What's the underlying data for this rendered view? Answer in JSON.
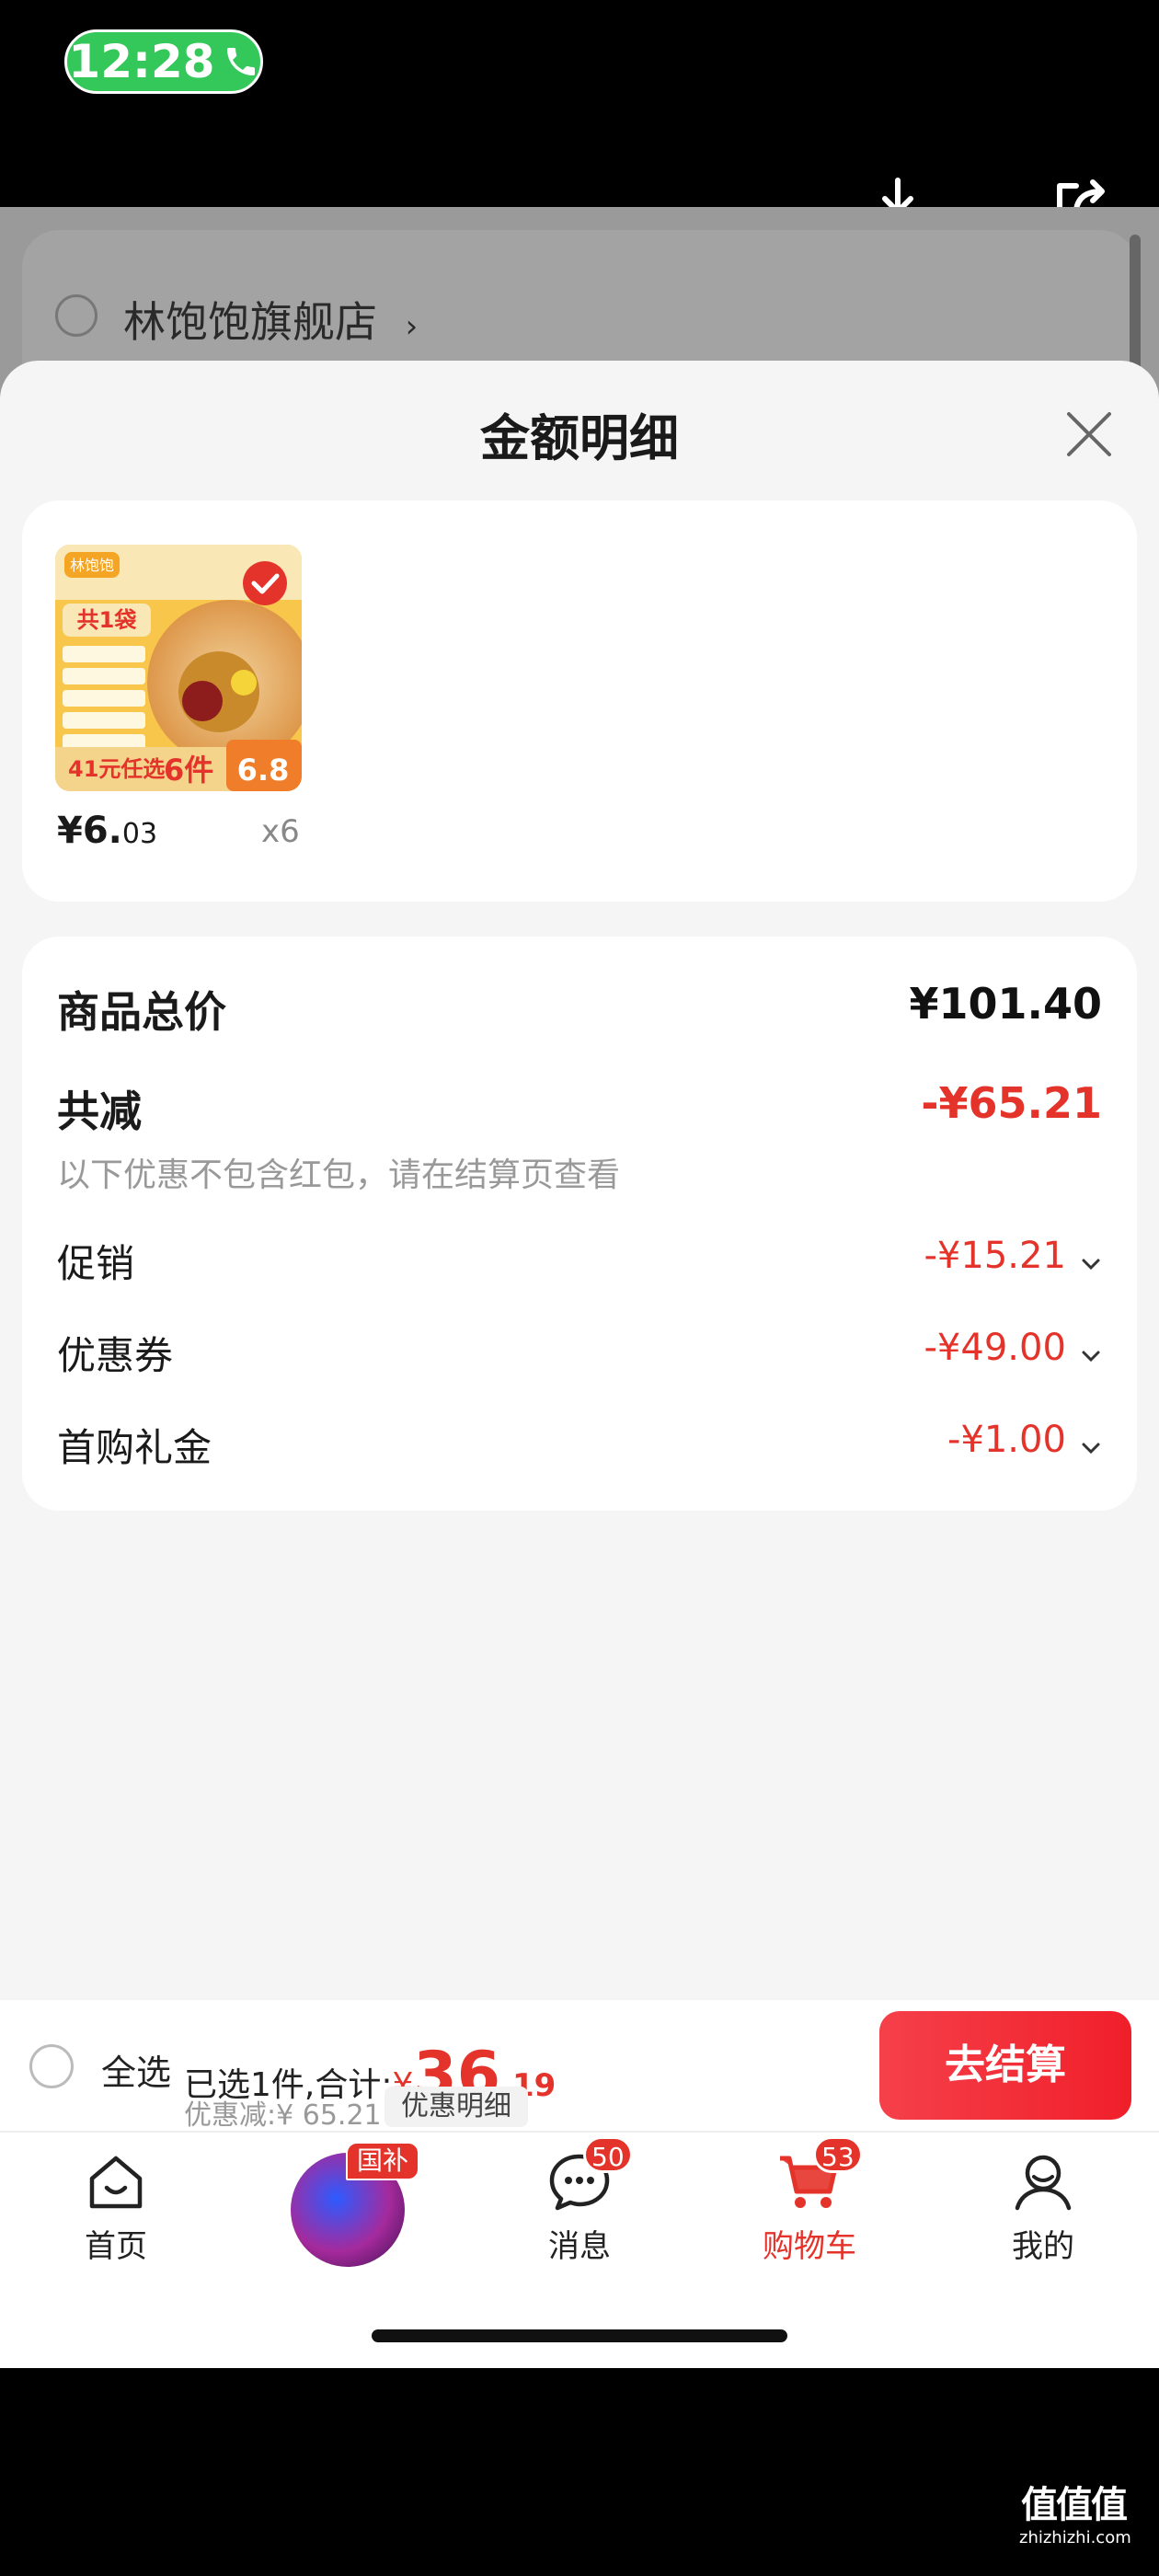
{
  "status": {
    "time": "12:28"
  },
  "store": {
    "name": "林饱饱旗舰店",
    "chevron": "›"
  },
  "sheet": {
    "title": "金额明细"
  },
  "product": {
    "price_main": "¥6.",
    "price_cents": "03",
    "qty": "x6",
    "image_texts": [
      "林饱饱",
      "共1袋",
      "41元任选",
      "6件",
      "6.8"
    ]
  },
  "summary": {
    "total_label": "商品总价",
    "total_value": "¥101.40",
    "reduce_label": "共减",
    "reduce_value": "-¥65.21",
    "note": "以下优惠不包含红包，请在结算页查看",
    "items": [
      {
        "label": "促销",
        "value": "-¥15.21"
      },
      {
        "label": "优惠券",
        "value": "-¥49.00"
      },
      {
        "label": "首购礼金",
        "value": "-¥1.00"
      }
    ]
  },
  "checkout": {
    "select_all": "全选",
    "selected_prefix": "已选1件,合计:",
    "yen": "¥",
    "amount_int": "36",
    "amount_dec": ".19",
    "discount": "优惠减:¥ 65.21",
    "detail_tag": "优惠明细",
    "pay": "去结算"
  },
  "tabs": [
    {
      "label": "首页",
      "icon": "home-icon"
    },
    {
      "label": "",
      "icon": "promo-icon",
      "badge": "国补"
    },
    {
      "label": "消息",
      "icon": "message-icon",
      "badge": "50"
    },
    {
      "label": "购物车",
      "icon": "cart-icon",
      "badge": "53"
    },
    {
      "label": "我的",
      "icon": "profile-icon"
    }
  ],
  "watermark": {
    "main": "值值值",
    "sub": "zhizhizhi.com"
  },
  "colors": {
    "accent": "#e4332a",
    "status_green": "#34c759"
  }
}
